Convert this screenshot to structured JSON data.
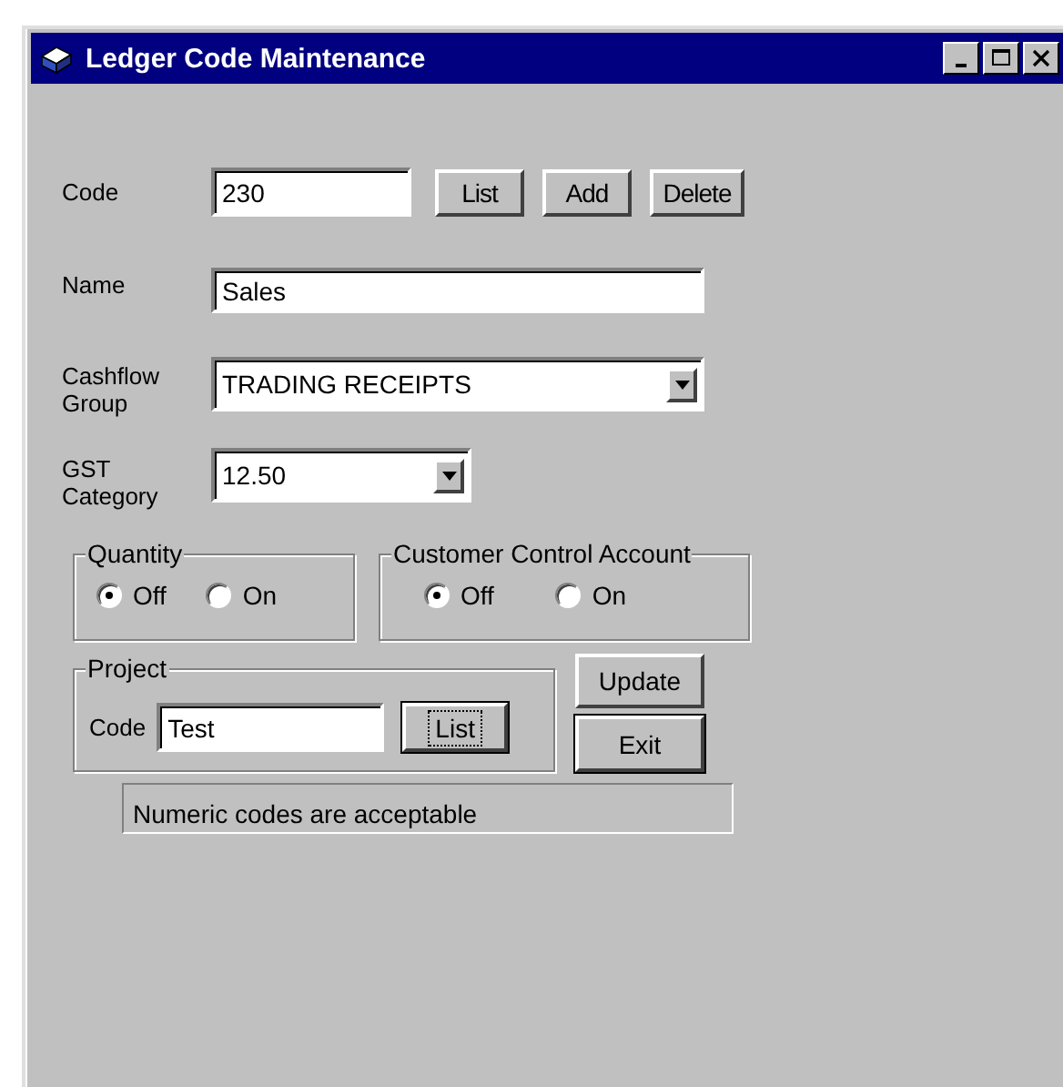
{
  "window": {
    "title": "Ledger Code Maintenance"
  },
  "code": {
    "label": "Code",
    "value": "230"
  },
  "code_buttons": [
    {
      "label": "List"
    },
    {
      "label": "Add"
    },
    {
      "label": "Delete"
    }
  ],
  "name": {
    "label": "Name",
    "value": "Sales"
  },
  "cashflow_group": {
    "label": "Cashflow Group",
    "value": "TRADING RECEIPTS"
  },
  "gst_category": {
    "label": "GST Category",
    "value": "12.50"
  },
  "radio_groups": [
    {
      "title": "Quantity",
      "options": [
        {
          "label": "Off",
          "selected": true
        },
        {
          "label": "On",
          "selected": false
        }
      ]
    },
    {
      "title": "Customer Control Account",
      "options": [
        {
          "label": "Off",
          "selected": true
        },
        {
          "label": "On",
          "selected": false
        }
      ]
    }
  ],
  "project": {
    "title": "Project",
    "code_label": "Code",
    "code_value": "Test",
    "list_button": {
      "label": "List",
      "focused": true
    }
  },
  "action_buttons": [
    {
      "label": "Update",
      "default": false
    },
    {
      "label": "Exit",
      "default": true
    }
  ],
  "status": "Numeric codes are acceptable"
}
